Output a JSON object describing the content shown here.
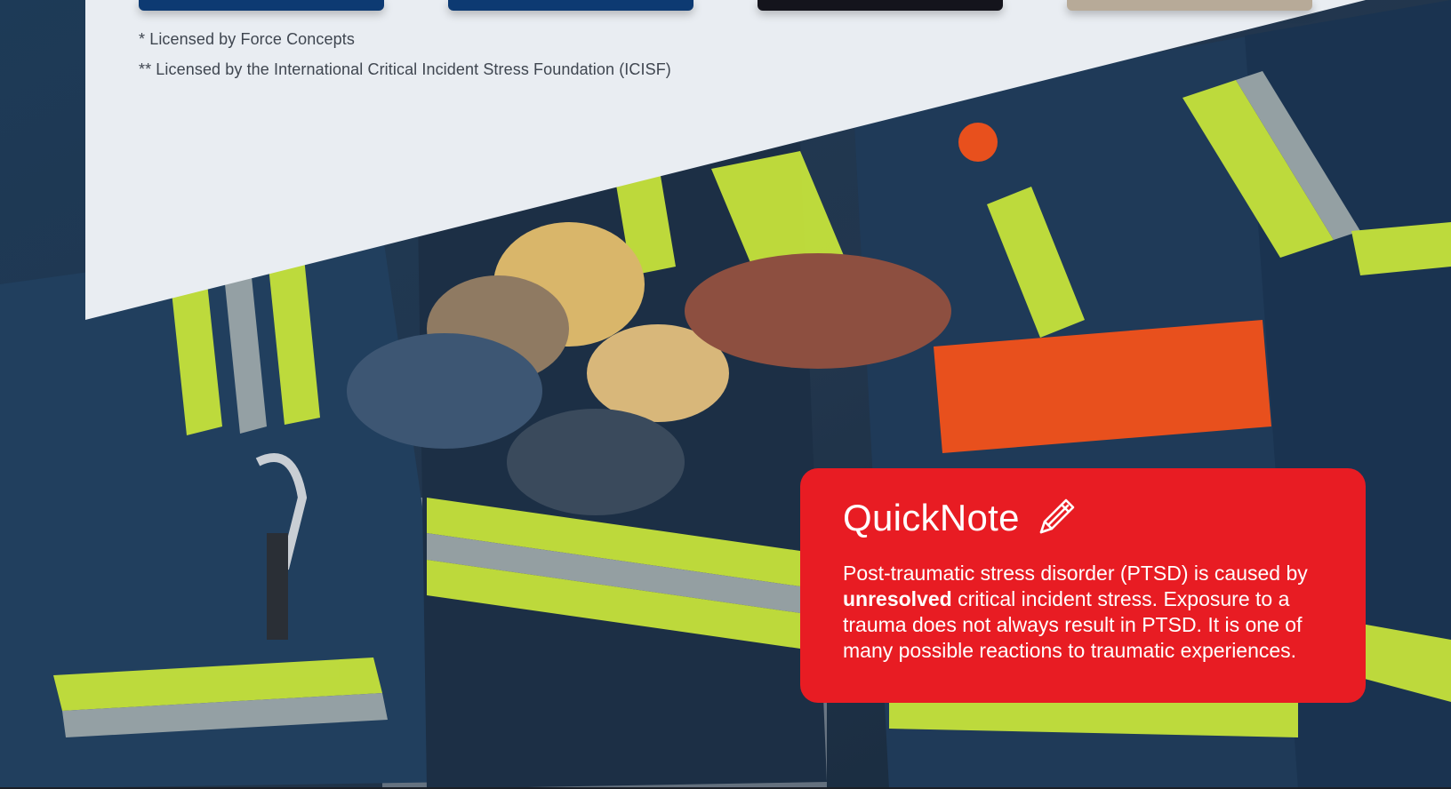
{
  "colors": {
    "panel_bg": "#e9edf2",
    "card_navy": "#0d3a72",
    "card_black": "#14141c",
    "accent_red": "#e81c23",
    "footnote_text": "#3f4650"
  },
  "footnotes": [
    "* Licensed by Force Concepts",
    "** Licensed by the International Critical Incident Stress Foundation (ICISF)"
  ],
  "quicknote": {
    "title": "QuickNote",
    "icon": "pencil-icon",
    "body_before": "Post-traumatic stress disorder (PTSD) is caused by",
    "body_bold": "unresolved",
    "body_after": "critical incident stress. Exposure to a trauma does not always result in PTSD. It is one of many possible reactions to traumatic experiences."
  },
  "hero_image": {
    "description_icon": "firefighters-hands-together-photo"
  }
}
